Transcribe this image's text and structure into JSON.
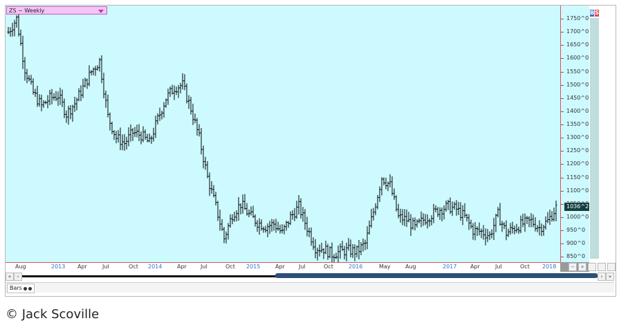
{
  "symbol_selector": {
    "label": "ZS ~ Weekly"
  },
  "badges": {
    "b": "B",
    "s": "S",
    "b_color": "#3b6fd8",
    "s_color": "#e04a4a"
  },
  "price_axis": {
    "labels": [
      "1750^0",
      "1700^0",
      "1650^0",
      "1600^0",
      "1550^0",
      "1500^0",
      "1450^0",
      "1400^0",
      "1350^0",
      "1300^0",
      "1250^0",
      "1200^0",
      "1150^0",
      "1100^0",
      "1050^0",
      "1000^0",
      "950^0",
      "900^0",
      "850^0"
    ],
    "values": [
      1750,
      1700,
      1650,
      1600,
      1550,
      1500,
      1450,
      1400,
      1350,
      1300,
      1250,
      1200,
      1150,
      1100,
      1050,
      1000,
      950,
      900,
      850
    ],
    "last_price": "1036^2"
  },
  "time_axis": {
    "labels": [
      {
        "text": "Aug",
        "year": false
      },
      {
        "text": "2013",
        "year": true
      },
      {
        "text": "Apr",
        "year": false
      },
      {
        "text": "Jul",
        "year": false
      },
      {
        "text": "Oct",
        "year": false
      },
      {
        "text": "2014",
        "year": true
      },
      {
        "text": "Apr",
        "year": false
      },
      {
        "text": "Jul",
        "year": false
      },
      {
        "text": "Oct",
        "year": false
      },
      {
        "text": "2015",
        "year": true
      },
      {
        "text": "Apr",
        "year": false
      },
      {
        "text": "Jul",
        "year": false
      },
      {
        "text": "Oct",
        "year": false
      },
      {
        "text": "2016",
        "year": true
      },
      {
        "text": "May",
        "year": false
      },
      {
        "text": "Aug",
        "year": false
      },
      {
        "text": "2017",
        "year": true
      },
      {
        "text": "Apr",
        "year": false
      },
      {
        "text": "Jul",
        "year": false
      },
      {
        "text": "Oct",
        "year": false
      },
      {
        "text": "2018",
        "year": true
      }
    ]
  },
  "chart_data": {
    "type": "bar",
    "style": "ohlc",
    "ylim": [
      830,
      1800
    ],
    "anchors": [
      {
        "date": "2012-08",
        "close": 1700
      },
      {
        "date": "2012-09",
        "close": 1750
      },
      {
        "date": "2012-10",
        "close": 1560
      },
      {
        "date": "2012-11",
        "close": 1470
      },
      {
        "date": "2012-12",
        "close": 1420
      },
      {
        "date": "2013-01",
        "close": 1450
      },
      {
        "date": "2013-02",
        "close": 1460
      },
      {
        "date": "2013-03",
        "close": 1390
      },
      {
        "date": "2013-04",
        "close": 1430
      },
      {
        "date": "2013-05",
        "close": 1490
      },
      {
        "date": "2013-06",
        "close": 1550
      },
      {
        "date": "2013-07",
        "close": 1590
      },
      {
        "date": "2013-08",
        "close": 1380
      },
      {
        "date": "2013-09",
        "close": 1300
      },
      {
        "date": "2013-10",
        "close": 1280
      },
      {
        "date": "2013-11",
        "close": 1320
      },
      {
        "date": "2013-12",
        "close": 1310
      },
      {
        "date": "2014-01",
        "close": 1280
      },
      {
        "date": "2014-02",
        "close": 1370
      },
      {
        "date": "2014-03",
        "close": 1450
      },
      {
        "date": "2014-04",
        "close": 1490
      },
      {
        "date": "2014-05",
        "close": 1500
      },
      {
        "date": "2014-06",
        "close": 1410
      },
      {
        "date": "2014-07",
        "close": 1300
      },
      {
        "date": "2014-08",
        "close": 1150
      },
      {
        "date": "2014-09",
        "close": 1040
      },
      {
        "date": "2014-10",
        "close": 920
      },
      {
        "date": "2014-11",
        "close": 1010
      },
      {
        "date": "2014-12",
        "close": 1050
      },
      {
        "date": "2015-01",
        "close": 1010
      },
      {
        "date": "2015-02",
        "close": 980
      },
      {
        "date": "2015-03",
        "close": 965
      },
      {
        "date": "2015-04",
        "close": 975
      },
      {
        "date": "2015-05",
        "close": 940
      },
      {
        "date": "2015-06",
        "close": 1000
      },
      {
        "date": "2015-07",
        "close": 1040
      },
      {
        "date": "2015-08",
        "close": 960
      },
      {
        "date": "2015-09",
        "close": 885
      },
      {
        "date": "2015-10",
        "close": 880
      },
      {
        "date": "2015-11",
        "close": 860
      },
      {
        "date": "2015-12",
        "close": 870
      },
      {
        "date": "2016-01",
        "close": 875
      },
      {
        "date": "2016-02",
        "close": 870
      },
      {
        "date": "2016-03",
        "close": 900
      },
      {
        "date": "2016-04",
        "close": 1020
      },
      {
        "date": "2016-05",
        "close": 1150
      },
      {
        "date": "2016-06",
        "close": 1120
      },
      {
        "date": "2016-07",
        "close": 1000
      },
      {
        "date": "2016-08",
        "close": 990
      },
      {
        "date": "2016-09",
        "close": 960
      },
      {
        "date": "2016-10",
        "close": 990
      },
      {
        "date": "2016-11",
        "close": 1010
      },
      {
        "date": "2016-12",
        "close": 1030
      },
      {
        "date": "2017-01",
        "close": 1040
      },
      {
        "date": "2017-02",
        "close": 1030
      },
      {
        "date": "2017-03",
        "close": 1000
      },
      {
        "date": "2017-04",
        "close": 950
      },
      {
        "date": "2017-05",
        "close": 945
      },
      {
        "date": "2017-06",
        "close": 930
      },
      {
        "date": "2017-07",
        "close": 1010
      },
      {
        "date": "2017-08",
        "close": 940
      },
      {
        "date": "2017-09",
        "close": 960
      },
      {
        "date": "2017-10",
        "close": 975
      },
      {
        "date": "2017-11",
        "close": 985
      },
      {
        "date": "2017-12",
        "close": 960
      },
      {
        "date": "2018-01",
        "close": 985
      },
      {
        "date": "2018-02",
        "close": 1036
      }
    ]
  },
  "toolbar": {
    "zoom_out": "−",
    "zoom_in": "+",
    "first": "«",
    "prev": "‹",
    "next": "›",
    "last": "»"
  },
  "tab": {
    "label": "Bars"
  },
  "credit": "© Jack Scoville",
  "colors": {
    "plot_bg": "#ccfaff",
    "bar": "#000000",
    "axis_line": "#e05050",
    "year_label": "#2a6fdb"
  }
}
